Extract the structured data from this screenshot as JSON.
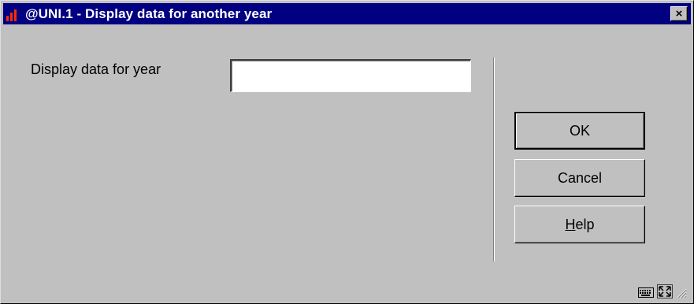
{
  "window": {
    "title": "@UNI.1 - Display data for another year",
    "close_glyph": "×",
    "icon": "bar-chart-icon",
    "title_bar_color": "#000080",
    "icon_color": "#ff2a00"
  },
  "form": {
    "year_label": "Display data for year",
    "year_value": "",
    "year_placeholder": ""
  },
  "buttons": {
    "ok_label": "OK",
    "cancel_label": "Cancel",
    "help_label_accel": "H",
    "help_label_rest": "elp"
  },
  "status_icons": [
    "keyboard-icon",
    "resize-icon",
    "size-grip-icon"
  ]
}
